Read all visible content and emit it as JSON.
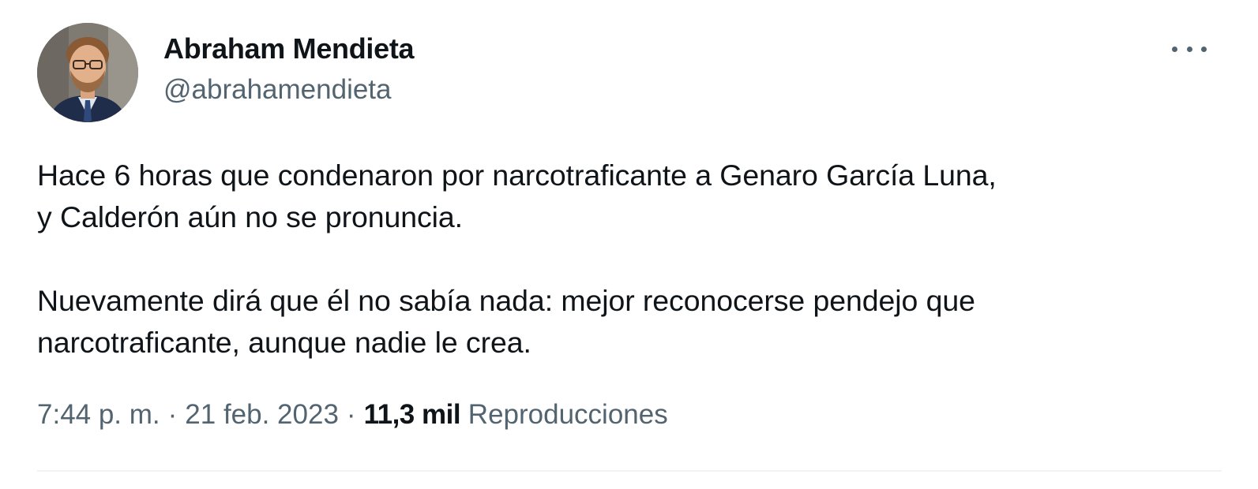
{
  "author": {
    "display_name": "Abraham Mendieta",
    "handle": "@abrahamendieta"
  },
  "tweet": {
    "paragraph1_line1": "Hace 6 horas que condenaron por narcotraficante a Genaro García Luna,",
    "paragraph1_line2": "y Calderón aún no se pronuncia.",
    "paragraph2_line1": "Nuevamente dirá que él no sabía nada: mejor reconocerse pendejo que",
    "paragraph2_line2": "narcotraficante, aunque nadie le crea."
  },
  "meta": {
    "time": "7:44 p. m.",
    "separator": "·",
    "date": "21 feb. 2023",
    "views_count": "11,3 mil",
    "views_label": "Reproducciones"
  },
  "icons": {
    "more": "more-horizontal-icon"
  },
  "colors": {
    "text_primary": "#0f1419",
    "text_secondary": "#536471",
    "divider": "#eff3f4",
    "background": "#ffffff"
  }
}
